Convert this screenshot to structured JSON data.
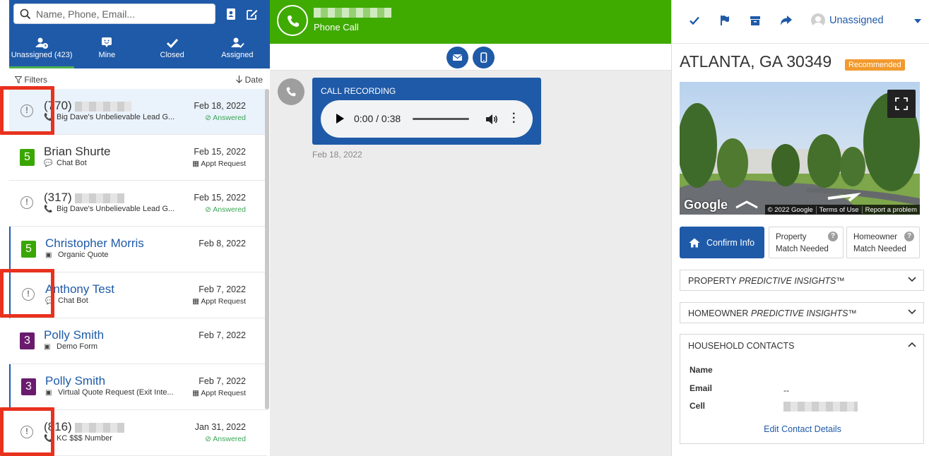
{
  "search": {
    "placeholder": "Name, Phone, Email..."
  },
  "tabs": [
    {
      "label": "Unassigned (423)",
      "icon": "user-clock-icon"
    },
    {
      "label": "Mine",
      "icon": "chat-user-icon"
    },
    {
      "label": "Closed",
      "icon": "check-icon"
    },
    {
      "label": "Assigned",
      "icon": "user-check-icon"
    }
  ],
  "filterbar": {
    "filters": "Filters",
    "sort": "Date"
  },
  "leads": [
    {
      "name": "(770)",
      "source": "Big Dave's Unbelievable Lead G...",
      "date": "Feb 18, 2022",
      "status": "Answered",
      "indicator": "!"
    },
    {
      "name": "Brian Shurte",
      "source": "Chat Bot",
      "date": "Feb 15, 2022",
      "status": "Appt Request",
      "indicator": "5"
    },
    {
      "name": "(317)",
      "source": "Big Dave's Unbelievable Lead G...",
      "date": "Feb 15, 2022",
      "status": "Answered",
      "indicator": "!"
    },
    {
      "name": "Christopher Morris",
      "source": "Organic Quote",
      "date": "Feb 8, 2022",
      "status": "",
      "indicator": "5"
    },
    {
      "name": "Anthony Test",
      "source": "Chat Bot",
      "date": "Feb 7, 2022",
      "status": "Appt Request",
      "indicator": "!"
    },
    {
      "name": "Polly Smith",
      "source": "Demo Form",
      "date": "Feb 7, 2022",
      "status": "",
      "indicator": "3"
    },
    {
      "name": "Polly Smith",
      "source": "Virtual Quote Request (Exit Inte...",
      "date": "Feb 7, 2022",
      "status": "Appt Request",
      "indicator": "3"
    },
    {
      "name": "(816)",
      "source": "KC $$$ Number",
      "date": "Jan 31, 2022",
      "status": "Answered",
      "indicator": "!"
    }
  ],
  "colors": {
    "brand_blue": "#1f5aa8",
    "call_green": "#3faa00",
    "badge_green": "#3aa600",
    "badge_purple": "#6a1b6e",
    "recommended_orange": "#f29a2e",
    "highlight_red": "#e8321e"
  },
  "conversation": {
    "type": "Phone Call",
    "recording_title": "CALL RECORDING",
    "player_time": "0:00 / 0:38",
    "recording_date": "Feb 18, 2022"
  },
  "details": {
    "assignee": "Unassigned",
    "address": "ATLANTA, GA 30349",
    "recommended_badge": "Recommended",
    "map": {
      "logo": "Google",
      "copyright": "© 2022 Google",
      "terms": "Terms of Use",
      "report": "Report a problem"
    },
    "confirm_button": "Confirm Info",
    "property_match": [
      "Property",
      "Match Needed"
    ],
    "homeowner_match": [
      "Homeowner",
      "Match Needed"
    ],
    "property_insights": {
      "prefix": "PROPERTY ",
      "emph": "PREDICTIVE INSIGHTS™"
    },
    "homeowner_insights": {
      "prefix": "HOMEOWNER ",
      "emph": "PREDICTIVE INSIGHTS™"
    },
    "household_contacts": "HOUSEHOLD CONTACTS",
    "fields": {
      "name_label": "Name",
      "email_label": "Email",
      "email_value": "--",
      "cell_label": "Cell"
    },
    "edit_link": "Edit Contact Details"
  }
}
